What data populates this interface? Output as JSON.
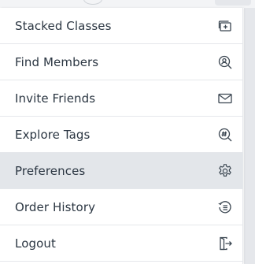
{
  "menu": {
    "items": [
      {
        "label": "Stacked Classes",
        "icon": "stack-plus-icon"
      },
      {
        "label": "Find Members",
        "icon": "search-member-icon"
      },
      {
        "label": "Invite Friends",
        "icon": "mail-icon"
      },
      {
        "label": "Explore Tags",
        "icon": "hashtag-search-icon"
      },
      {
        "label": "Preferences",
        "icon": "gear-icon",
        "active": true
      },
      {
        "label": "Order History",
        "icon": "history-icon"
      },
      {
        "label": "Logout",
        "icon": "logout-icon"
      }
    ]
  },
  "colors": {
    "text": "#2b3642",
    "icon": "#3b4651",
    "active_bg": "#e3e6ea",
    "divider": "#e5e7eb"
  }
}
